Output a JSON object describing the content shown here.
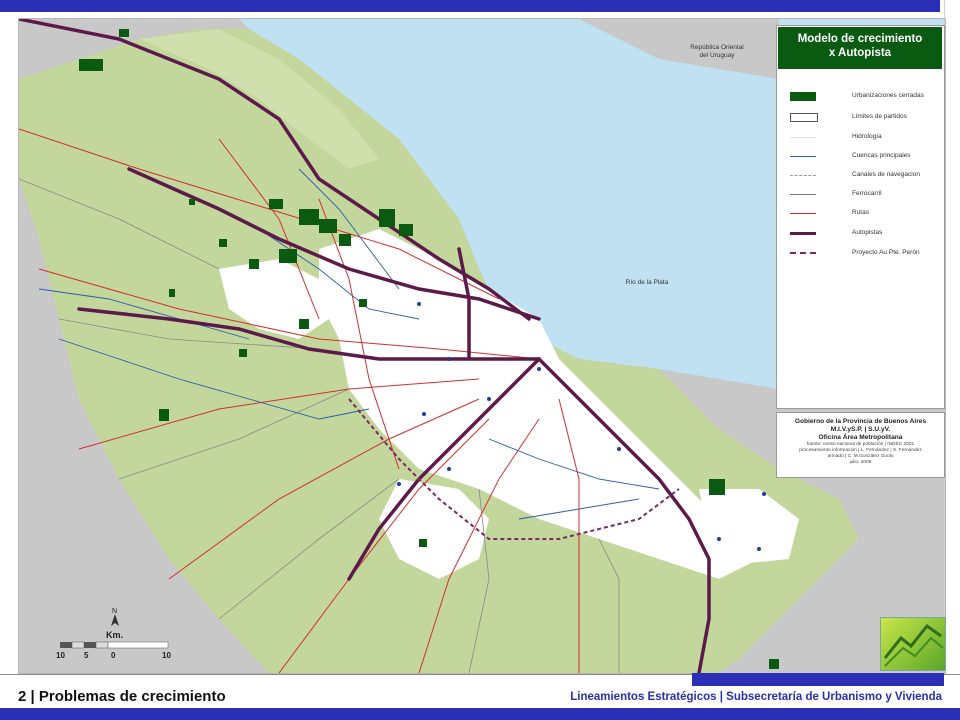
{
  "legend": {
    "title_line1": "Modelo de crecimiento",
    "title_line2": "x Autopista",
    "items": [
      {
        "label": "Urbanizaciones cerradas",
        "color": "#0b5a12"
      },
      {
        "label": "Límites de partidos",
        "color": "#555555"
      },
      {
        "label": "Hidrología",
        "color": "#dddddd"
      },
      {
        "label": "Cuencas principales",
        "color": "#2a5ea8"
      },
      {
        "label": "Canales de navegacion",
        "color": "#999999"
      },
      {
        "label": "Ferrocarril",
        "color": "#777777"
      },
      {
        "label": "Rutas",
        "color": "#d03030"
      },
      {
        "label": "Autopistas",
        "color": "#5c1a4a"
      },
      {
        "label": "Proyecto Au Pte. Perón",
        "color": "#7a2a60"
      }
    ]
  },
  "credits": {
    "line1": "Gobierno de la Provincia de Buenos Aires",
    "line2": "M.I.V.yS.P. | S.U.yV.",
    "line3": "Oficina Área Metropolitana",
    "small1": "fuente: censo nacional de población | INDEC 2001",
    "small2": "procesamiento información | L. Fernández | S. Fernández",
    "small3": "armado | C. M.González Guolo",
    "small4": "julio. 2006"
  },
  "map_labels": {
    "uruguay_line1": "República Oriental",
    "uruguay_line2": "del Uruguay",
    "river": "Río de la Plata"
  },
  "scale": {
    "north": "N",
    "unit": "Km.",
    "ticks": [
      "10",
      "5",
      "0",
      "10"
    ]
  },
  "footer": {
    "title": "2 | Problemas de crecimiento",
    "right": "Lineamientos Estratégicos  | Subsecretaría de Urbanismo y Vivienda"
  },
  "colors": {
    "brand_blue": "#2b2fb8",
    "land": "#c3d69b",
    "water": "#bfe1f1",
    "urban": "#ffffff",
    "gated": "#0b5a12",
    "highway": "#5c1a4a",
    "route": "#d03030",
    "river_line": "#2a5ea8"
  }
}
